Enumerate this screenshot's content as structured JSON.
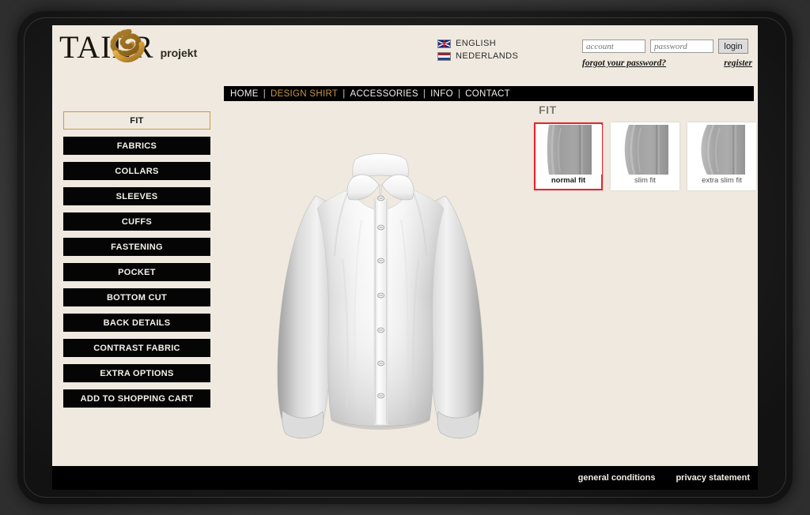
{
  "brand": {
    "wordmark_part1": "TAIL",
    "wordmark_part2": "R",
    "subtitle": "projekt",
    "tape_icon": "measuring-tape-icon"
  },
  "languages": [
    {
      "label": "ENGLISH",
      "flag": "flag-uk-icon"
    },
    {
      "label": "NEDERLANDS",
      "flag": "flag-nl-icon"
    }
  ],
  "login": {
    "account_placeholder": "account",
    "account_value": "",
    "password_placeholder": "password",
    "password_value": "",
    "login_label": "login",
    "forgot_label": "forgot your password?",
    "register_label": "register"
  },
  "nav": {
    "items": [
      {
        "label": "HOME",
        "active": false
      },
      {
        "label": "DESIGN SHIRT",
        "active": true
      },
      {
        "label": "ACCESSORIES",
        "active": false
      },
      {
        "label": "INFO",
        "active": false
      },
      {
        "label": "CONTACT",
        "active": false
      }
    ],
    "separator": "|"
  },
  "sidebar": {
    "items": [
      {
        "label": "FIT",
        "active": true
      },
      {
        "label": "FABRICS",
        "active": false
      },
      {
        "label": "COLLARS",
        "active": false
      },
      {
        "label": "SLEEVES",
        "active": false
      },
      {
        "label": "CUFFS",
        "active": false
      },
      {
        "label": "FASTENING",
        "active": false
      },
      {
        "label": "POCKET",
        "active": false
      },
      {
        "label": "BOTTOM CUT",
        "active": false
      },
      {
        "label": "BACK DETAILS",
        "active": false
      },
      {
        "label": "CONTRAST FABRIC",
        "active": false
      },
      {
        "label": "EXTRA OPTIONS",
        "active": false
      },
      {
        "label": "ADD TO SHOPPING CART",
        "active": false
      }
    ]
  },
  "preview": {
    "alt": "white-dress-shirt-preview"
  },
  "fit_panel": {
    "title": "FIT",
    "options": [
      {
        "label": "normal fit",
        "selected": true
      },
      {
        "label": "slim fit",
        "selected": false
      },
      {
        "label": "extra slim fit",
        "selected": false
      }
    ]
  },
  "footer": {
    "links": [
      {
        "label": "general conditions"
      },
      {
        "label": "privacy statement"
      }
    ]
  },
  "colors": {
    "page_bg": "#efe9df",
    "accent_gold": "#c8973f",
    "selected_red": "#e8232a",
    "bar_black": "#000000",
    "heading_gray": "#7b7b78"
  }
}
